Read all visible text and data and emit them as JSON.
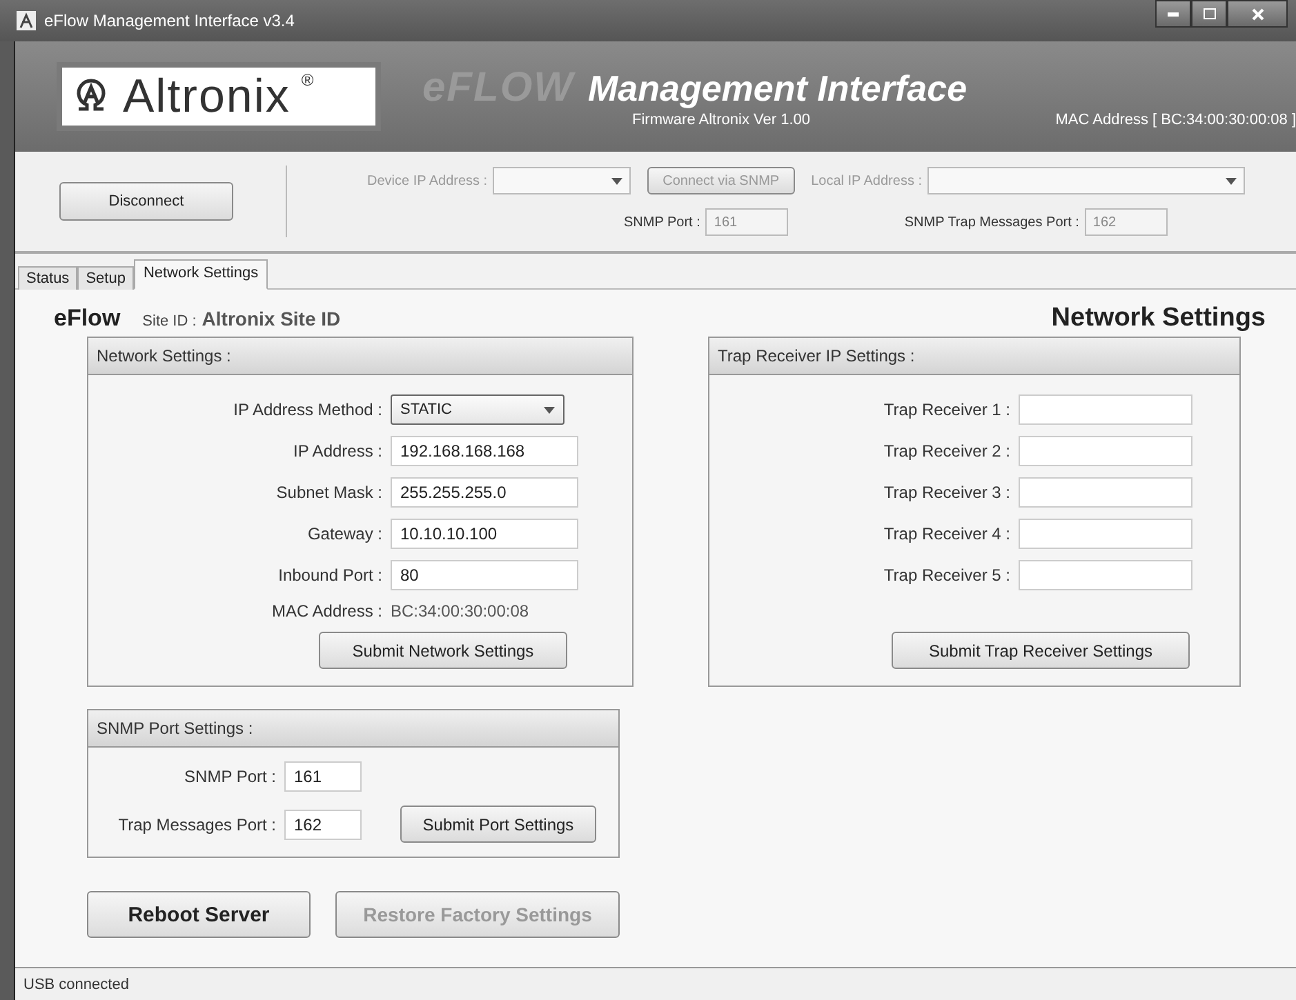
{
  "window": {
    "title": "eFlow Management Interface v3.4"
  },
  "banner": {
    "brand": "Altronix",
    "registered": "®",
    "product": "eFLOW",
    "subtitle": "Management Interface",
    "firmware": "Firmware Altronix Ver 1.00",
    "mac": "MAC Address [ BC:34:00:30:00:08 ]"
  },
  "toolbar": {
    "disconnect": "Disconnect",
    "device_ip": {
      "label": "Device IP Address :",
      "disabled": true
    },
    "connect": {
      "label": "Connect via SNMP",
      "disabled": true
    },
    "local_ip": {
      "label": "Local IP Address :",
      "disabled": true
    },
    "snmp_port": {
      "label": "SNMP Port :",
      "value": "161",
      "disabled": true
    },
    "trap_port": {
      "label": "SNMP Trap Messages Port :",
      "value": "162",
      "disabled": true
    }
  },
  "tabs": [
    {
      "label": "Status",
      "selected": false
    },
    {
      "label": "Setup",
      "selected": false
    },
    {
      "label": "Network Settings",
      "selected": true
    }
  ],
  "page": {
    "brand": "eFlow",
    "site_label": "Site ID :",
    "site_id": "Altronix Site ID",
    "title": "Network Settings"
  },
  "network": {
    "title": "Network Settings :",
    "rows": [
      {
        "kind": "select",
        "label": "IP Address Method :",
        "value": "STATIC"
      },
      {
        "kind": "input",
        "label": "IP Address :",
        "value": "192.168.168.168"
      },
      {
        "kind": "input",
        "label": "Subnet Mask :",
        "value": "255.255.255.0"
      },
      {
        "kind": "input",
        "label": "Gateway :",
        "value": "10.10.10.100"
      },
      {
        "kind": "input",
        "label": "Inbound Port :",
        "value": "80"
      },
      {
        "kind": "text",
        "label": "MAC Address :",
        "value": "BC:34:00:30:00:08"
      }
    ],
    "submit": "Submit Network Settings"
  },
  "trap": {
    "title": "Trap Receiver IP Settings :",
    "rows": [
      {
        "label": "Trap Receiver 1 :"
      },
      {
        "label": "Trap Receiver 2 :"
      },
      {
        "label": "Trap Receiver 3 :"
      },
      {
        "label": "Trap Receiver 4 :"
      },
      {
        "label": "Trap Receiver 5 :"
      }
    ],
    "submit": "Submit Trap Receiver Settings"
  },
  "snmp": {
    "title": "SNMP Port Settings :",
    "rows": [
      {
        "label": "SNMP Port :",
        "value": "161"
      },
      {
        "label": "Trap Messages Port :",
        "value": "162"
      }
    ],
    "submit": "Submit Port Settings"
  },
  "actions": [
    {
      "label": "Reboot Server",
      "disabled": false
    },
    {
      "label": "Restore Factory Settings",
      "disabled": true
    }
  ],
  "status_bar": {
    "text": "USB connected"
  }
}
